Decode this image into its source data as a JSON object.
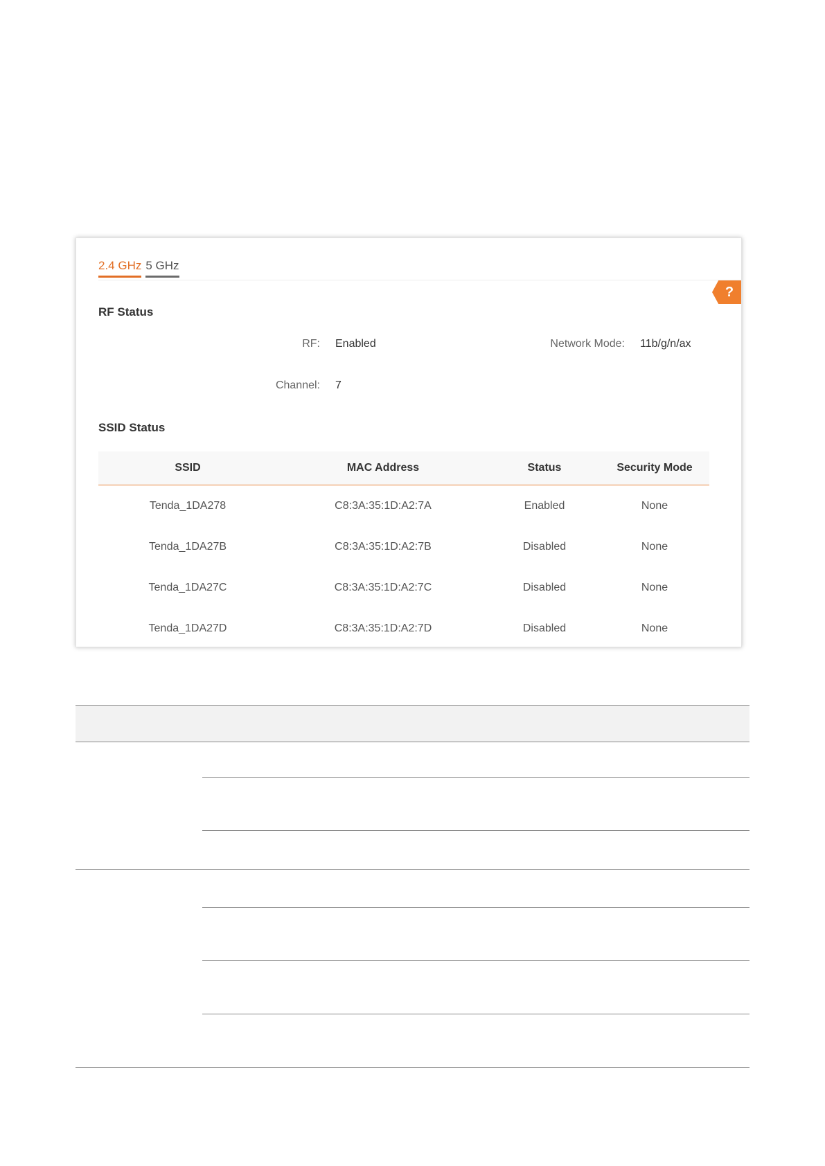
{
  "tabs": [
    {
      "label": "2.4 GHz",
      "active": true
    },
    {
      "label": "5 GHz",
      "active": false
    }
  ],
  "help": {
    "label": "?"
  },
  "rf_status": {
    "title": "RF Status",
    "rf_label": "RF:",
    "rf_value": "Enabled",
    "network_mode_label": "Network Mode:",
    "network_mode_value": "11b/g/n/ax",
    "channel_label": "Channel:",
    "channel_value": "7"
  },
  "ssid_status": {
    "title": "SSID Status",
    "columns": [
      "SSID",
      "MAC Address",
      "Status",
      "Security Mode"
    ],
    "rows": [
      [
        "Tenda_1DA278",
        "C8:3A:35:1D:A2:7A",
        "Enabled",
        "None"
      ],
      [
        "Tenda_1DA27B",
        "C8:3A:35:1D:A2:7B",
        "Disabled",
        "None"
      ],
      [
        "Tenda_1DA27C",
        "C8:3A:35:1D:A2:7C",
        "Disabled",
        "None"
      ],
      [
        "Tenda_1DA27D",
        "C8:3A:35:1D:A2:7D",
        "Disabled",
        "None"
      ]
    ]
  },
  "colors": {
    "accent": "#e26f26",
    "help_tag": "#f07f2d"
  }
}
